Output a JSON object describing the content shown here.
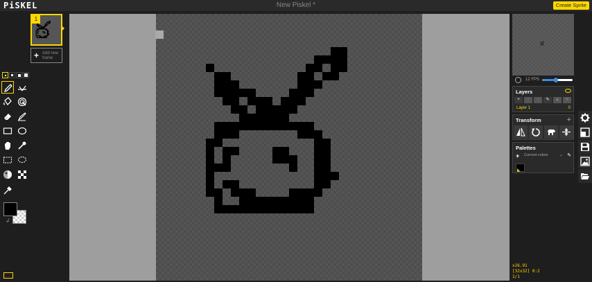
{
  "header": {
    "logo": "PiSKEL",
    "document_title": "New Piskel *",
    "create_sprite_label": "Create Sprite"
  },
  "frames": {
    "items": [
      {
        "number": "1"
      }
    ],
    "add_frame_label": "Add new frame"
  },
  "tools": {
    "pen_sizes": [
      "1",
      "2",
      "3",
      "4"
    ],
    "selected_pen_size": "1",
    "items": [
      {
        "name": "pen-tool",
        "icon": "pencil-icon",
        "active": true
      },
      {
        "name": "vertical-mirror-pen-tool",
        "icon": "mirror-pen-icon"
      },
      {
        "name": "paint-bucket-tool",
        "icon": "bucket-icon"
      },
      {
        "name": "paint-all-same-color-tool",
        "icon": "spiral-icon"
      },
      {
        "name": "eraser-tool",
        "icon": "eraser-icon"
      },
      {
        "name": "stroke-tool",
        "icon": "line-icon"
      },
      {
        "name": "rectangle-tool",
        "icon": "rectangle-icon"
      },
      {
        "name": "circle-tool",
        "icon": "circle-icon"
      },
      {
        "name": "move-tool",
        "icon": "hand-icon"
      },
      {
        "name": "shape-selection-tool",
        "icon": "magic-wand-icon"
      },
      {
        "name": "rectangle-selection-tool",
        "icon": "dashed-rectangle-icon"
      },
      {
        "name": "lasso-selection-tool",
        "icon": "lasso-icon"
      },
      {
        "name": "lighten-tool",
        "icon": "lighten-icon"
      },
      {
        "name": "dithering-tool",
        "icon": "checker-icon"
      },
      {
        "name": "color-picker-tool",
        "icon": "eyedropper-icon"
      }
    ],
    "primary_color": "#000000",
    "secondary_color": "transparent"
  },
  "colors": {
    "accent": "#ffd700",
    "background": "#1e1e1e",
    "panel": "#2a2a2a",
    "canvas_outside": "#9e9e9e",
    "pixel": "#000000"
  },
  "canvas": {
    "sprite_size": [
      32,
      32
    ],
    "pixels": [
      [
        17,
        4
      ],
      [
        17,
        5
      ],
      [
        17,
        6
      ],
      [
        17,
        7
      ],
      [
        18,
        4
      ],
      [
        18,
        5
      ],
      [
        18,
        6
      ],
      [
        15,
        5
      ],
      [
        15,
        6
      ],
      [
        16,
        5
      ],
      [
        16,
        7
      ],
      [
        14,
        6
      ],
      [
        14,
        7
      ],
      [
        13,
        7
      ],
      [
        13,
        8
      ],
      [
        13,
        9
      ],
      [
        14,
        8
      ],
      [
        14,
        9
      ],
      [
        15,
        8
      ],
      [
        12,
        9
      ],
      [
        12,
        10
      ],
      [
        13,
        10
      ],
      [
        11,
        10
      ],
      [
        11,
        11
      ],
      [
        12,
        11
      ],
      [
        10,
        11
      ],
      [
        10,
        12
      ],
      [
        11,
        12
      ],
      [
        2,
        6
      ],
      [
        3,
        7
      ],
      [
        3,
        8
      ],
      [
        4,
        7
      ],
      [
        4,
        8
      ],
      [
        5,
        8
      ],
      [
        3,
        9
      ],
      [
        4,
        9
      ],
      [
        5,
        9
      ],
      [
        6,
        9
      ],
      [
        7,
        9
      ],
      [
        4,
        10
      ],
      [
        5,
        10
      ],
      [
        7,
        10
      ],
      [
        8,
        10
      ],
      [
        9,
        10
      ],
      [
        5,
        11
      ],
      [
        6,
        11
      ],
      [
        8,
        11
      ],
      [
        9,
        11
      ],
      [
        6,
        12
      ],
      [
        7,
        12
      ],
      [
        8,
        12
      ],
      [
        9,
        12
      ],
      [
        3,
        13
      ],
      [
        4,
        13
      ],
      [
        5,
        13
      ],
      [
        6,
        13
      ],
      [
        7,
        13
      ],
      [
        8,
        13
      ],
      [
        9,
        13
      ],
      [
        10,
        13
      ],
      [
        11,
        13
      ],
      [
        12,
        13
      ],
      [
        13,
        13
      ],
      [
        14,
        13
      ],
      [
        3,
        14
      ],
      [
        4,
        14
      ],
      [
        5,
        14
      ],
      [
        13,
        14
      ],
      [
        14,
        14
      ],
      [
        15,
        14
      ],
      [
        2,
        15
      ],
      [
        3,
        15
      ],
      [
        15,
        15
      ],
      [
        16,
        15
      ],
      [
        2,
        16
      ],
      [
        4,
        16
      ],
      [
        5,
        16
      ],
      [
        10,
        16
      ],
      [
        11,
        16
      ],
      [
        15,
        16
      ],
      [
        16,
        16
      ],
      [
        2,
        17
      ],
      [
        4,
        17
      ],
      [
        10,
        17
      ],
      [
        11,
        17
      ],
      [
        12,
        17
      ],
      [
        15,
        17
      ],
      [
        16,
        17
      ],
      [
        2,
        18
      ],
      [
        3,
        18
      ],
      [
        4,
        18
      ],
      [
        12,
        18
      ],
      [
        15,
        18
      ],
      [
        16,
        18
      ],
      [
        2,
        19
      ],
      [
        15,
        19
      ],
      [
        16,
        19
      ],
      [
        17,
        19
      ],
      [
        2,
        20
      ],
      [
        4,
        20
      ],
      [
        5,
        20
      ],
      [
        15,
        20
      ],
      [
        16,
        20
      ],
      [
        2,
        21
      ],
      [
        3,
        21
      ],
      [
        5,
        21
      ],
      [
        6,
        21
      ],
      [
        14,
        21
      ],
      [
        15,
        21
      ],
      [
        3,
        22
      ],
      [
        6,
        22
      ],
      [
        7,
        22
      ],
      [
        8,
        22
      ],
      [
        9,
        22
      ],
      [
        10,
        22
      ],
      [
        11,
        22
      ],
      [
        12,
        22
      ],
      [
        13,
        22
      ],
      [
        14,
        22
      ],
      [
        3,
        23
      ],
      [
        4,
        23
      ],
      [
        5,
        23
      ],
      [
        6,
        23
      ],
      [
        7,
        23
      ],
      [
        8,
        23
      ],
      [
        9,
        23
      ],
      [
        10,
        23
      ],
      [
        11,
        23
      ],
      [
        12,
        23
      ],
      [
        13,
        23
      ],
      [
        14,
        23
      ],
      [
        6,
        21
      ],
      [
        7,
        21
      ],
      [
        12,
        21
      ],
      [
        13,
        21
      ]
    ]
  },
  "preview": {
    "fps_label": "12 FPS",
    "fps_value": 12,
    "fps_fraction": 0.45
  },
  "layers": {
    "title": "Layers",
    "items": [
      {
        "name": "Layer 1",
        "opacity": "0"
      }
    ]
  },
  "transform": {
    "title": "Transform",
    "buttons": [
      "flip-icon",
      "rotate-icon",
      "clone-icon",
      "center-icon"
    ]
  },
  "palettes": {
    "title": "Palettes",
    "selected": "Current colors",
    "swatches": [
      "#000000"
    ]
  },
  "status": {
    "zoom": "x26.91",
    "size_cursor": "[32x32] 0:2",
    "frame": "1/1"
  },
  "drawer": [
    "gear-icon",
    "resize-icon",
    "save-icon",
    "image-export-icon",
    "folder-open-icon"
  ]
}
